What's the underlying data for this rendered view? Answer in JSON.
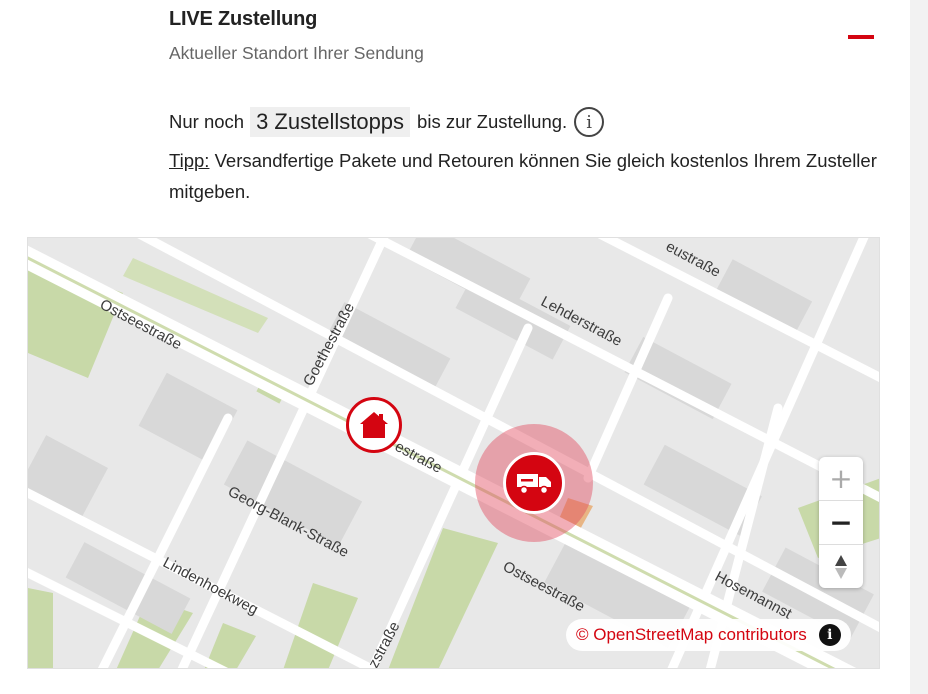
{
  "section": {
    "title": "LIVE Zustellung",
    "subtitle": "Aktueller Standort Ihrer Sendung",
    "collapse_icon": "minus-icon"
  },
  "delivery": {
    "prefix": "Nur noch",
    "stops_badge": "3 Zustellstopps",
    "suffix": "bis zur Zustellung.",
    "info_icon": "info-icon"
  },
  "tip": {
    "label": "Tipp:",
    "text": " Versandfertige Pakete und Retouren können Sie gleich kostenlos Ihrem Zusteller mitgeben."
  },
  "map": {
    "streets": {
      "ostseestrasse_west": "Ostseestraße",
      "goethestrasse": "Goethestraße",
      "lehderstrasse": "Lehderstraße",
      "ostseestrasse_top": "eustraße",
      "ostseestrasse_mid": "estraße",
      "georg_blank": "Georg-Blank-Straße",
      "lindenhoekweg": "Lindenhoekweg",
      "ostseestrasse_south": "Ostseestraße",
      "hosemann": "Hosemannst",
      "zstrasse": "zstraße"
    },
    "markers": {
      "home_icon": "home-icon",
      "van_icon": "delivery-van-icon"
    },
    "controls": {
      "zoom_in": "+",
      "zoom_out": "−",
      "compass_icon": "compass-icon"
    },
    "attribution": "© OpenStreetMap contributors",
    "attribution_icon": "info-icon"
  },
  "colors": {
    "brand_red": "#d40511",
    "map_background": "#e8e8e8",
    "park_green": "#c8d9a8",
    "road_white": "#ffffff"
  }
}
